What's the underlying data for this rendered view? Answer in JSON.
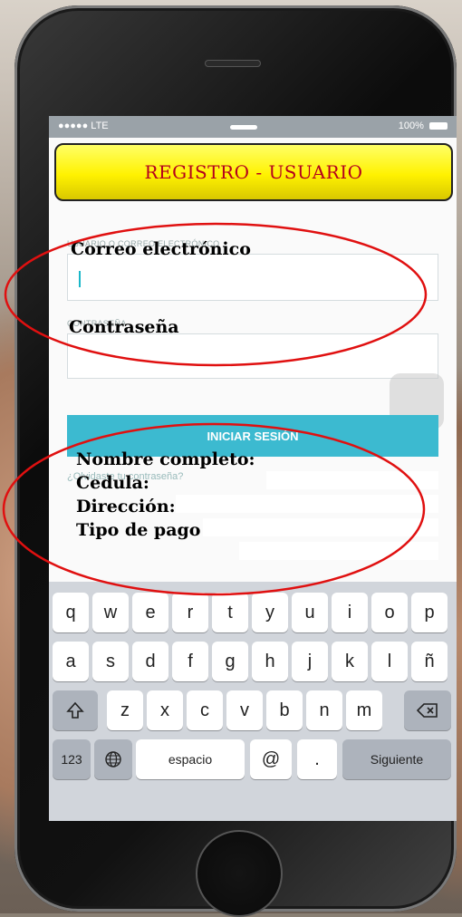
{
  "status_bar": {
    "signal": "●●●●● LTE",
    "battery": "100%"
  },
  "banner": {
    "title": "REGISTRO - USUARIO"
  },
  "login_form": {
    "email_small_label": "USUARIO O CORREO ELECTRÓNICO",
    "email_label": "Correo electrónico",
    "password_small_label": "CONTRASEÑA",
    "password_label": "Contraseña",
    "login_button": "INICIAR SESIÓN",
    "forgot_link": "¿Olvidaste tu contraseña?"
  },
  "registration_fields": {
    "full_name": "Nombre completo:",
    "id": "Cedula:",
    "address": "Dirección:",
    "payment": "Tipo de pago"
  },
  "keyboard": {
    "row1": [
      "q",
      "w",
      "e",
      "r",
      "t",
      "y",
      "u",
      "i",
      "o",
      "p"
    ],
    "row2": [
      "a",
      "s",
      "d",
      "f",
      "g",
      "h",
      "j",
      "k",
      "l",
      "ñ"
    ],
    "row3": [
      "z",
      "x",
      "c",
      "v",
      "b",
      "n",
      "m"
    ],
    "numbers_key": "123",
    "space_key": "espacio",
    "at_key": "@",
    "dot_key": ".",
    "next_key": "Siguiente"
  },
  "colors": {
    "accent": "#3cbad0",
    "banner_yellow": "#fff200",
    "banner_text": "#b4001e",
    "annotation_red": "#e01010"
  }
}
